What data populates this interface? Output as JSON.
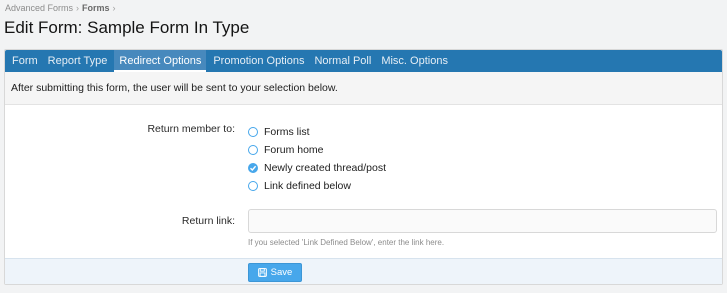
{
  "breadcrumb": {
    "items": [
      "Advanced Forms",
      "Forms"
    ],
    "separator": "›"
  },
  "page_title": "Edit Form: Sample Form In Type",
  "tabs": [
    {
      "label": "Form",
      "active": false
    },
    {
      "label": "Report Type",
      "active": false
    },
    {
      "label": "Redirect Options",
      "active": true
    },
    {
      "label": "Promotion Options",
      "active": false
    },
    {
      "label": "Normal Poll",
      "active": false
    },
    {
      "label": "Misc. Options",
      "active": false
    }
  ],
  "intro_text": "After submitting this form, the user will be sent to your selection below.",
  "return_member": {
    "label": "Return member to:",
    "options": [
      {
        "label": "Forms list",
        "checked": false
      },
      {
        "label": "Forum home",
        "checked": false
      },
      {
        "label": "Newly created thread/post",
        "checked": true
      },
      {
        "label": "Link defined below",
        "checked": false
      }
    ]
  },
  "return_link": {
    "label": "Return link:",
    "value": "",
    "placeholder": "",
    "hint": "If you selected 'Link Defined Below', enter the link here."
  },
  "save_button": {
    "label": "Save",
    "icon": "save-icon"
  },
  "colors": {
    "tab_bar": "#2577b1",
    "accent": "#47a7eb",
    "footer_bg": "#eef4fa"
  }
}
